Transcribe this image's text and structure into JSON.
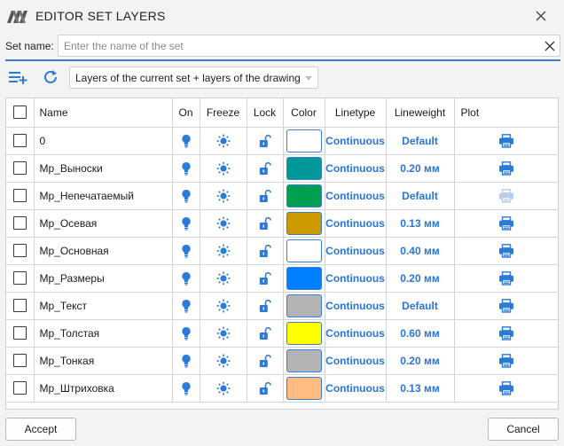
{
  "window": {
    "title": "EDITOR SET LAYERS",
    "logo_icon": "app-logo-icon",
    "close_icon": "close-icon"
  },
  "set_name": {
    "label": "Set name:",
    "value": "",
    "placeholder": "Enter the name of the set"
  },
  "toolbar": {
    "add_icon": "add-layer-icon",
    "refresh_icon": "refresh-icon",
    "filter_selected": "Layers of the current set + layers of the drawing"
  },
  "colors": {
    "accent": "#2a74d6",
    "icon_blue": "#2b7bd8",
    "icon_disabled": "#b9cde6"
  },
  "table": {
    "headers": {
      "name": "Name",
      "on": "On",
      "freeze": "Freeze",
      "lock": "Lock",
      "color": "Color",
      "linetype": "Linetype",
      "lineweight": "Lineweight",
      "plot": "Plot"
    },
    "rows": [
      {
        "name": "0",
        "color": "#ffffff",
        "linetype": "Continuous",
        "lineweight": "Default",
        "plot": true
      },
      {
        "name": "Мр_Выноски",
        "color": "#009999",
        "linetype": "Continuous",
        "lineweight": "0.20 мм",
        "plot": true
      },
      {
        "name": "Мр_Непечатаемый",
        "color": "#00a050",
        "linetype": "Continuous",
        "lineweight": "Default",
        "plot": false
      },
      {
        "name": "Мр_Осевая",
        "color": "#cc9900",
        "linetype": "Continuous",
        "lineweight": "0.13 мм",
        "plot": true
      },
      {
        "name": "Мр_Основная",
        "color": "#ffffff",
        "linetype": "Continuous",
        "lineweight": "0.40 мм",
        "plot": true
      },
      {
        "name": "Мр_Размеры",
        "color": "#0080ff",
        "linetype": "Continuous",
        "lineweight": "0.20 мм",
        "plot": true
      },
      {
        "name": "Мр_Текст",
        "color": "#b3b3b3",
        "linetype": "Continuous",
        "lineweight": "Default",
        "plot": true
      },
      {
        "name": "Мр_Толстая",
        "color": "#ffff00",
        "linetype": "Continuous",
        "lineweight": "0.60 мм",
        "plot": true
      },
      {
        "name": "Мр_Тонкая",
        "color": "#b3b3b3",
        "linetype": "Continuous",
        "lineweight": "0.20 мм",
        "plot": true
      },
      {
        "name": "Мр_Штриховка",
        "color": "#ffbb80",
        "linetype": "Continuous",
        "lineweight": "0.13 мм",
        "plot": true
      }
    ]
  },
  "buttons": {
    "accept": "Accept",
    "cancel": "Cancel"
  }
}
